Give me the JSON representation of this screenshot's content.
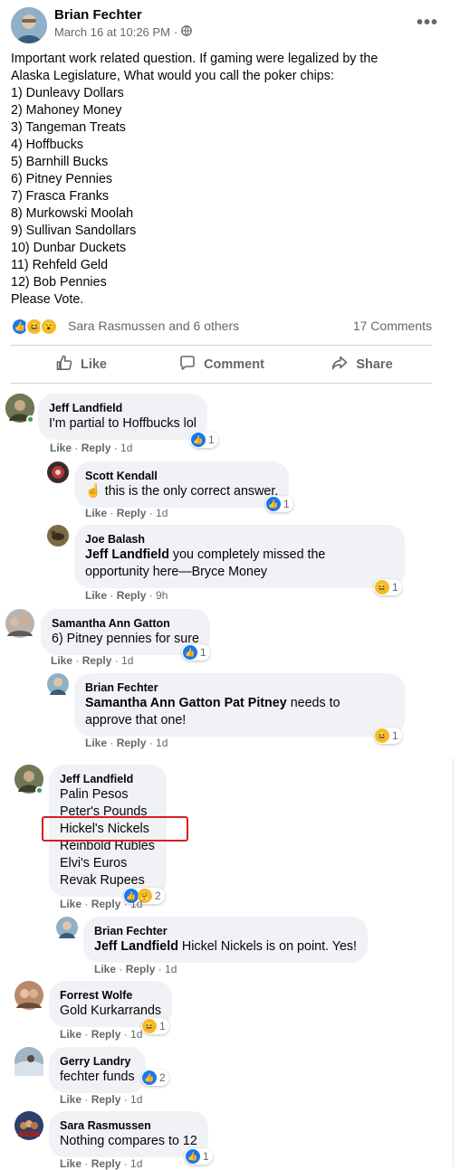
{
  "post": {
    "author": "Brian Fechter",
    "timestamp": "March 16 at 10:26 PM",
    "privacy_separator": "·",
    "privacy_icon": "globe-icon",
    "more_label": "•••",
    "lines": [
      "Important work related question. If gaming were legalized by the",
      "Alaska Legislature, What would you call the poker chips:",
      "1) Dunleavy Dollars",
      "2) Mahoney Money",
      "3) Tangeman Treats",
      "4) Hoffbucks",
      "5) Barnhill Bucks",
      "6) Pitney Pennies",
      "7) Frasca Franks",
      "8) Murkowski Moolah",
      "9) Sullivan Sandollars",
      "10) Dunbar Duckets",
      "11) Rehfeld Geld",
      "12) Bob Pennies",
      "Please Vote."
    ],
    "reactions_text": "Sara Rasmussen and 6 others",
    "comments_text": "17 Comments",
    "actions": {
      "like": "Like",
      "comment": "Comment",
      "share": "Share"
    }
  },
  "footer": {
    "like": "Like",
    "reply": "Reply",
    "sep": " · "
  },
  "comments": [
    {
      "name": "Jeff Landfield",
      "text": "I'm partial to Hoffbucks lol",
      "time": "1d",
      "reaction_count": "1"
    },
    {
      "name": "Scott Kendall",
      "emoji": "☝",
      "text": "this is the only correct answer.",
      "time": "1d",
      "reaction_count": "1"
    },
    {
      "name": "Joe Balash",
      "mention": "Jeff Landfield",
      "text_1": "you completely missed the",
      "text_2": "opportunity here—Bryce Money",
      "time": "9h",
      "reaction_count": "1"
    },
    {
      "name": "Samantha Ann Gatton",
      "text": "6) Pitney pennies for sure",
      "time": "1d",
      "reaction_count": "1"
    },
    {
      "name": "Brian Fechter",
      "mention": "Samantha Ann Gatton Pat Pitney",
      "text_1": "needs to",
      "text_2": "approve that one!",
      "time": "1d",
      "reaction_count": "1"
    },
    {
      "name": "Jeff Landfield",
      "lines": [
        "Palin Pesos",
        "Peter's Pounds",
        "Hickel's Nickels",
        "Reinbold Rubles",
        "Elvi's Euros",
        "Revak Rupees"
      ],
      "time": "1d",
      "reaction_count": "2"
    },
    {
      "name": "Brian Fechter",
      "mention": "Jeff Landfield",
      "text": "Hickel Nickels is on point. Yes!",
      "time": "1d"
    },
    {
      "name": "Forrest Wolfe",
      "text": "Gold Kurkarrands",
      "time": "1d",
      "reaction_count": "1"
    },
    {
      "name": "Gerry Landry",
      "text": "fechter funds",
      "time": "1d",
      "reaction_count": "2"
    },
    {
      "name": "Sara Rasmussen",
      "text": "Nothing compares to 12",
      "time": "1d",
      "reaction_count": "1"
    }
  ],
  "colors": {
    "accent": "#1877f2",
    "bubble": "#f0f2f5",
    "meta": "#65676b",
    "highlight": "#d61f1f",
    "online": "#31a24c"
  }
}
